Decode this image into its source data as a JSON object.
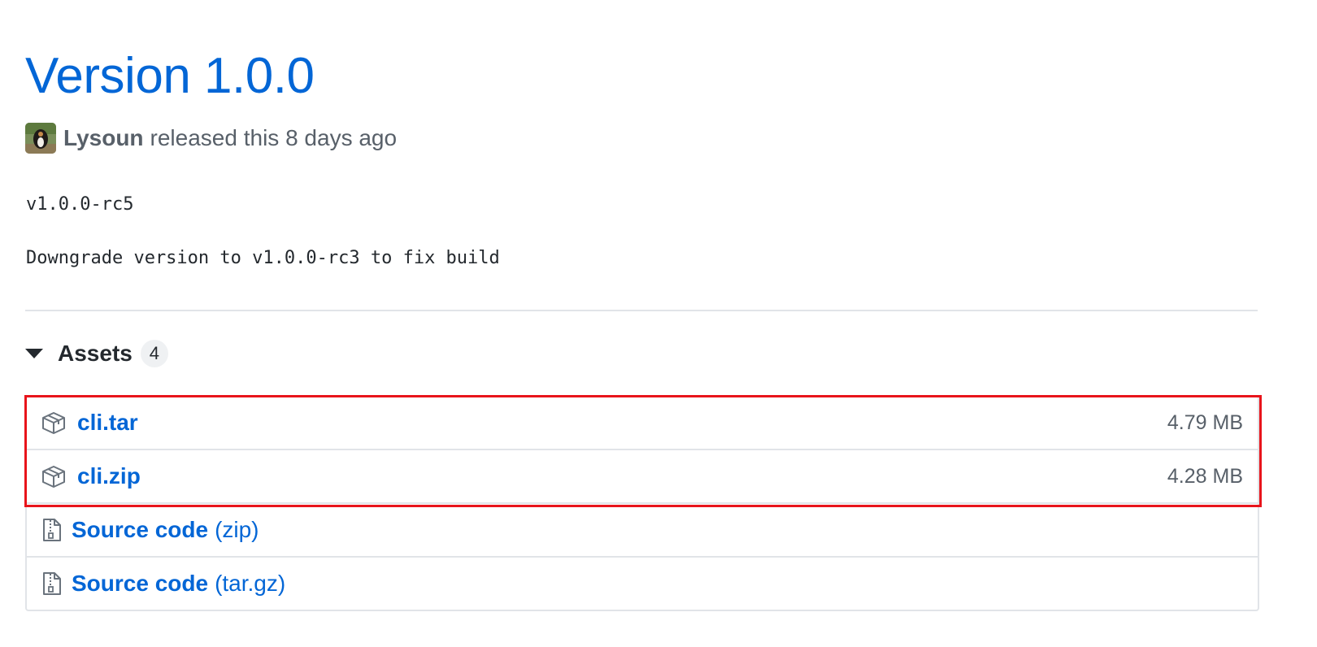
{
  "release": {
    "title": "Version 1.0.0",
    "author": "Lysoun",
    "released_text": "released this 8 days ago",
    "body": [
      "v1.0.0-rc5",
      "Downgrade version to v1.0.0-rc3 to fix build"
    ]
  },
  "assets": {
    "label": "Assets",
    "count": "4",
    "files": [
      {
        "name": "cli.tar",
        "size": "4.79 MB",
        "icon": "package-icon"
      },
      {
        "name": "cli.zip",
        "size": "4.28 MB",
        "icon": "package-icon"
      }
    ],
    "source": [
      {
        "name": "Source code",
        "suffix": "(zip)",
        "icon": "file-zip-icon"
      },
      {
        "name": "Source code",
        "suffix": "(tar.gz)",
        "icon": "file-zip-icon"
      }
    ]
  },
  "colors": {
    "link": "#0366d6",
    "muted": "#586069",
    "border": "#e1e4e8",
    "highlight": "#e8141b"
  }
}
